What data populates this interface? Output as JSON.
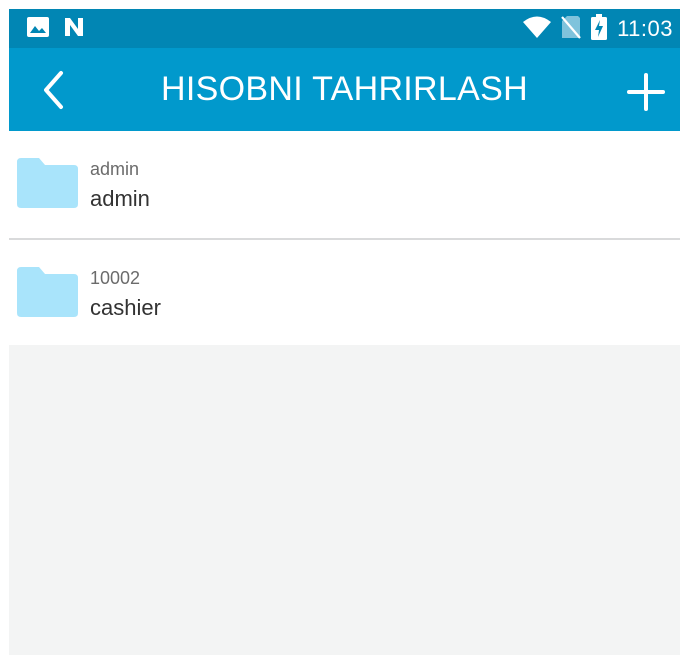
{
  "status_bar": {
    "time": "11:03",
    "icons": [
      "image-icon",
      "n-notification-icon",
      "wifi-icon",
      "no-sim-icon",
      "battery-charging-icon"
    ]
  },
  "app_bar": {
    "title": "HISOBNI TAHRIRLASH",
    "back_icon": "chevron-left-icon",
    "add_icon": "plus-icon"
  },
  "accounts": [
    {
      "id_label": "admin",
      "name": "admin",
      "icon": "folder-icon"
    },
    {
      "id_label": "10002",
      "name": "cashier",
      "icon": "folder-icon"
    }
  ],
  "colors": {
    "status_bar": "#0186b4",
    "app_bar": "#0199cc",
    "folder": "#a9e4fb",
    "background": "#f3f4f4"
  }
}
